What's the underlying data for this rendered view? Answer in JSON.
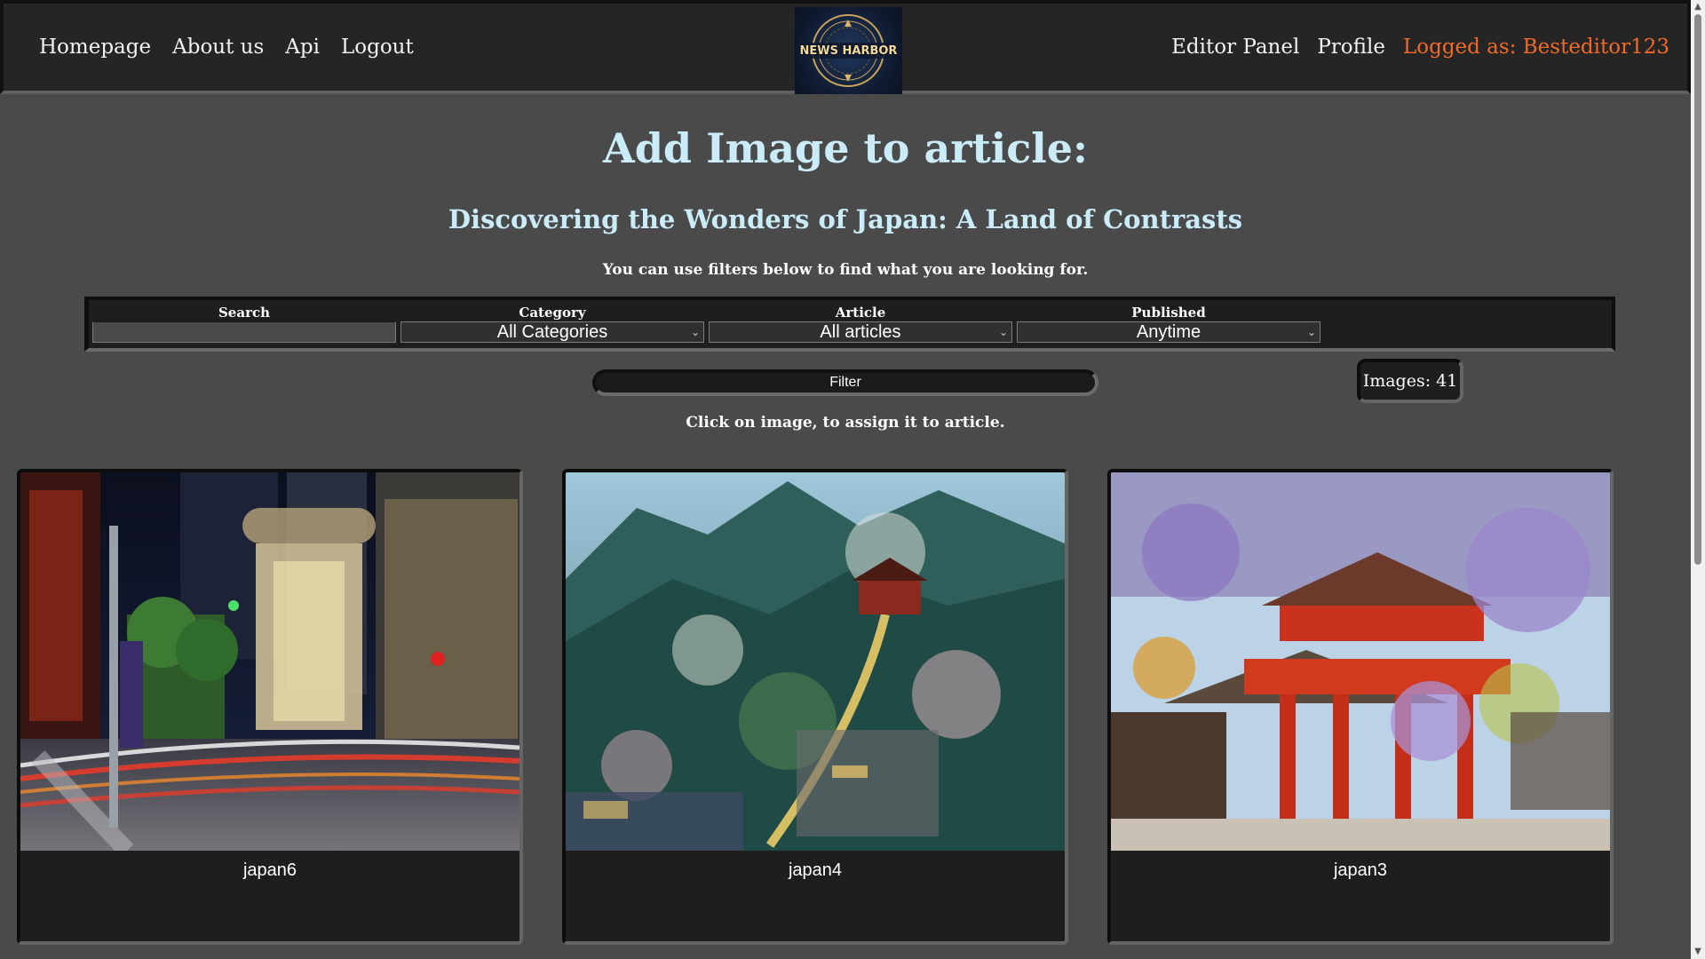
{
  "nav": {
    "left": [
      "Homepage",
      "About us",
      "Api",
      "Logout"
    ],
    "right": [
      "Editor Panel",
      "Profile"
    ],
    "logged_as": "Logged as: Besteditor123"
  },
  "logo": {
    "text": "NEWS HARBOR"
  },
  "page": {
    "title": "Add Image to article:",
    "article_title": "Discovering the Wonders of Japan: A Land of Contrasts",
    "filter_hint": "You can use filters below to find what you are looking for.",
    "click_hint": "Click on image, to assign it to article."
  },
  "filters": {
    "search_label": "Search",
    "search_value": "",
    "category_label": "Category",
    "category_value": "All Categories",
    "article_label": "Article",
    "article_value": "All articles",
    "published_label": "Published",
    "published_value": "Anytime",
    "button_label": "Filter"
  },
  "images_count": "Images: 41",
  "images": [
    {
      "name": "japan6",
      "scene": "city-night"
    },
    {
      "name": "japan4",
      "scene": "mountain-village"
    },
    {
      "name": "japan3",
      "scene": "shrine-wisteria"
    }
  ],
  "colors": {
    "background": "#4a4a4a",
    "header": "#252525",
    "heading": "#c9ecf8",
    "logged_as": "#f06a2a",
    "panel": "#1e1e1e"
  },
  "icons": [
    "chevron-down-icon",
    "scroll-up-icon",
    "scroll-down-icon"
  ]
}
